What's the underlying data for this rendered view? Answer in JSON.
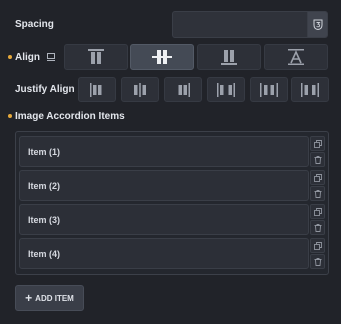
{
  "spacing": {
    "label": "Spacing",
    "value": "",
    "unit_icon": "unit-toggle-icon"
  },
  "align": {
    "label": "Align",
    "responsive_icon": "desktop-icon",
    "options": [
      {
        "name": "align-top-icon"
      },
      {
        "name": "align-middle-icon",
        "active": true
      },
      {
        "name": "align-bottom-icon"
      },
      {
        "name": "align-baseline-icon"
      }
    ]
  },
  "justify_align": {
    "label": "Justify Align",
    "options": [
      {
        "name": "justify-start-icon"
      },
      {
        "name": "justify-center-icon"
      },
      {
        "name": "justify-end-icon"
      },
      {
        "name": "justify-space-between-icon"
      },
      {
        "name": "justify-space-around-icon"
      },
      {
        "name": "justify-space-evenly-icon"
      }
    ]
  },
  "items_section": {
    "label": "Image Accordion Items",
    "items": [
      {
        "label": "Item (1)"
      },
      {
        "label": "Item (2)"
      },
      {
        "label": "Item (3)"
      },
      {
        "label": "Item (4)"
      }
    ],
    "add_button_label": "ADD ITEM"
  },
  "colors": {
    "background": "#212329",
    "accent_dot": "#e6a93c",
    "active_button": "#444a55"
  }
}
